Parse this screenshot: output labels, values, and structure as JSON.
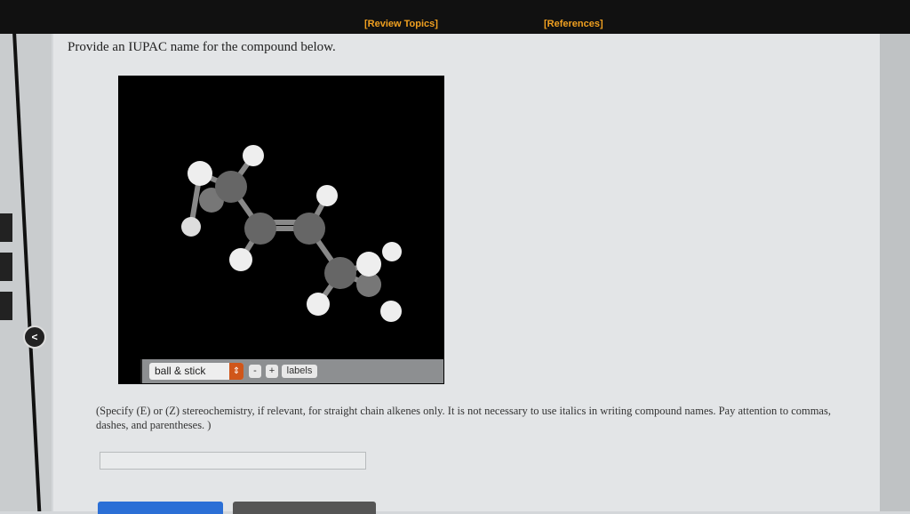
{
  "header": {
    "review_topics": "[Review Topics]",
    "references": "[References]"
  },
  "question": {
    "prompt": "Provide an IUPAC name for the compound below.",
    "hint": "(Specify (E) or (Z) stereochemistry, if relevant, for straight chain alkenes only. It is not necessary to use italics in writing compound names. Pay attention to commas, dashes, and parentheses. )"
  },
  "viewer": {
    "style_select": "ball & stick",
    "minus": "-",
    "plus": "+",
    "labels": "labels",
    "accent": "#d0561a"
  },
  "answer": {
    "value": ""
  },
  "sidebar": {
    "collapse_glyph": "<"
  }
}
